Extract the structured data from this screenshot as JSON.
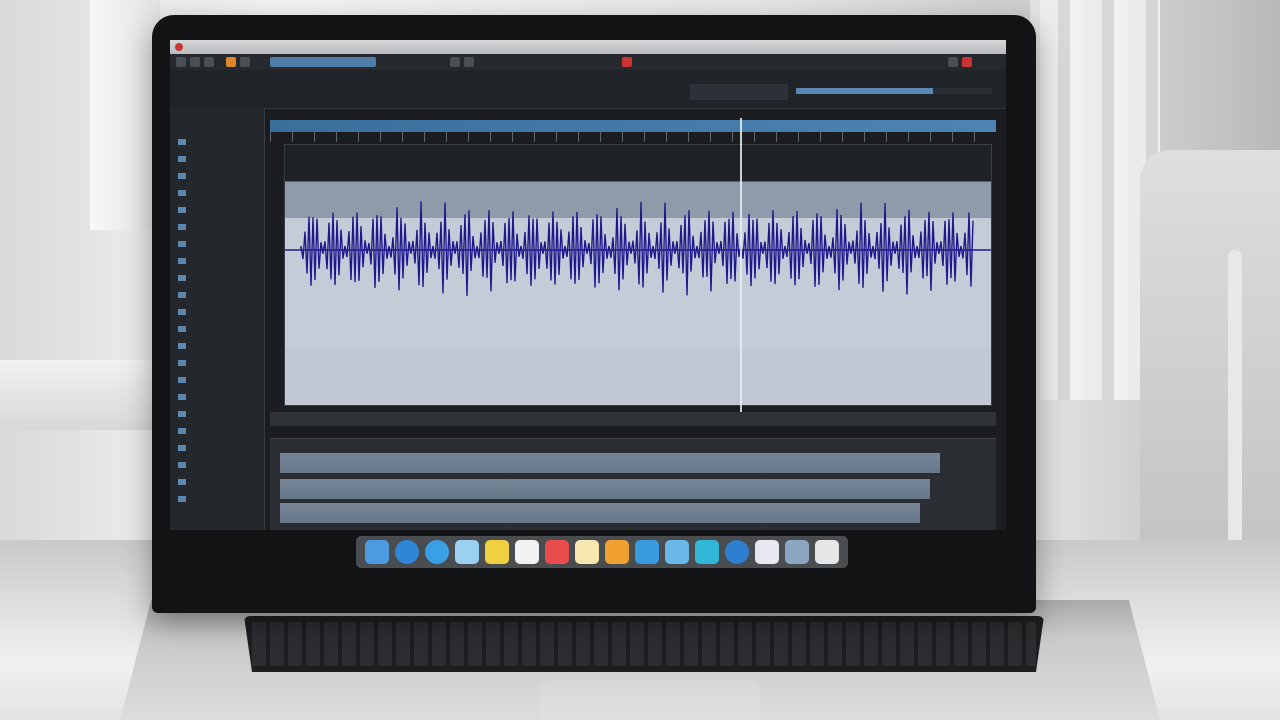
{
  "scene": {
    "description_label": "",
    "timecode": "",
    "menubar": {
      "title": ""
    },
    "sidebar": {
      "items": [
        "",
        "",
        "",
        "",
        "",
        "",
        "",
        "",
        "",
        "",
        "",
        "",
        "",
        "",
        "",
        "",
        "",
        "",
        "",
        "",
        "",
        ""
      ]
    },
    "dock_apps": [
      {
        "icon": "finder-icon",
        "color": "#4c9be0"
      },
      {
        "icon": "safari-icon",
        "color": "#2f86d8"
      },
      {
        "icon": "browser-icon",
        "color": "#3aa0e6"
      },
      {
        "icon": "preview-icon",
        "color": "#9ad0f0"
      },
      {
        "icon": "notes-icon",
        "color": "#f0d040"
      },
      {
        "icon": "calendar-icon",
        "color": "#f2f2f2"
      },
      {
        "icon": "photos-icon",
        "color": "#e84c4c"
      },
      {
        "icon": "stickies-icon",
        "color": "#f6e6b0"
      },
      {
        "icon": "ibooks-icon",
        "color": "#f0a030"
      },
      {
        "icon": "app-store-icon",
        "color": "#3a9ae0"
      },
      {
        "icon": "mail-icon",
        "color": "#6ab8e8"
      },
      {
        "icon": "messages-icon",
        "color": "#30b8d8"
      },
      {
        "icon": "system-prefs-icon",
        "color": "#2e7fd0"
      },
      {
        "icon": "itunes-icon",
        "color": "#e8e8f0"
      },
      {
        "icon": "iphoto-icon",
        "color": "#8aa6c0"
      },
      {
        "icon": "trash-icon",
        "color": "#e6e6e6"
      }
    ],
    "colors": {
      "waveform": "#1f1a8c",
      "timeline_bar": "#4c84b3",
      "screen_bg": "#1b1d20"
    }
  }
}
